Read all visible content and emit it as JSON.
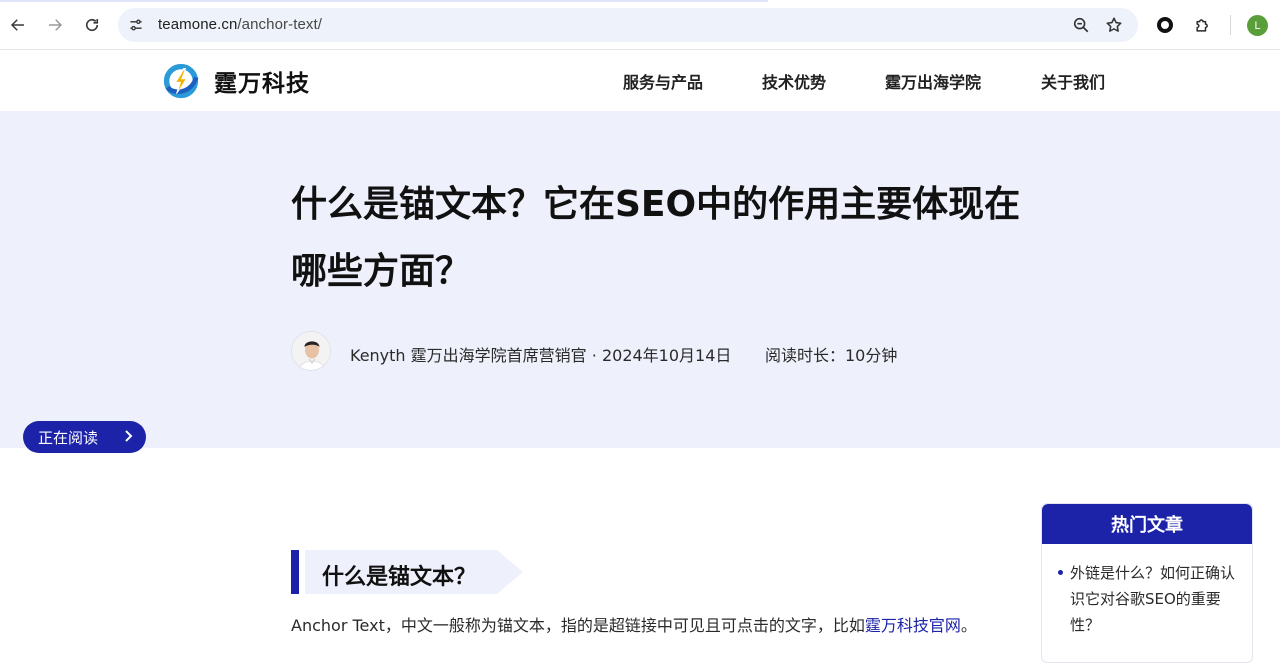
{
  "browser": {
    "url_domain": "teamone.cn",
    "url_path": "/anchor-text/",
    "profile_initial": "L"
  },
  "site": {
    "brand_name": "霆万科技",
    "nav": [
      "服务与产品",
      "技术优势",
      "霆万出海学院",
      "关于我们"
    ]
  },
  "article": {
    "title": "什么是锚文本？它在SEO中的作用主要体现在哪些方面？",
    "author": "Kenyth",
    "author_role": "霆万出海学院首席营销官",
    "separator": "·",
    "date": "2024年10月14日",
    "read_time": "阅读时长：10分钟",
    "reading_indicator": "正在阅读",
    "section_heading": "什么是锚文本？",
    "paragraph_text": "Anchor Text，中文一般称为锚文本，指的是超链接中可见且可点击的文字，比如",
    "paragraph_link": "霆万科技官网",
    "paragraph_end": "。"
  },
  "sidebar": {
    "title": "热门文章",
    "items": [
      "外链是什么？如何正确认识它对谷歌SEO的重要性？"
    ]
  },
  "colors": {
    "brand": "#1c23a8",
    "hero_bg": "#eef0fb",
    "logo_blue": "#2a9ad8"
  }
}
